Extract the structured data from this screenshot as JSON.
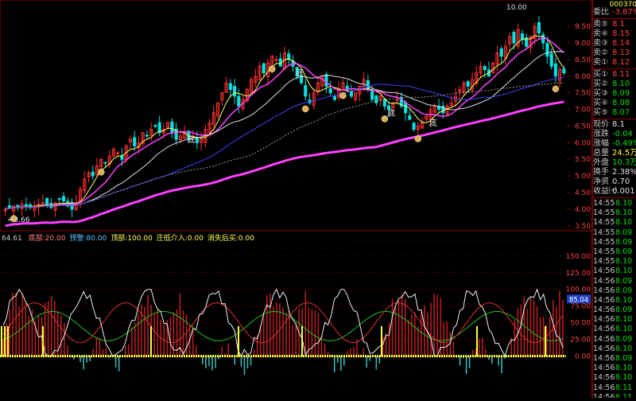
{
  "colors": {
    "up": "#ff3030",
    "down": "#00e0e0",
    "ma1": "#ffff60",
    "ma2": "#ff40ff",
    "ma3": "#e0e0e0",
    "ma4": "#4040ff",
    "ma5": "#888888",
    "bull": "#ff40ff",
    "grid": "#8b0000"
  },
  "top_chart": {
    "high_label": "10.00",
    "low_label": "←3.66",
    "signal_label": "底",
    "axis_ticks": [
      "9.50",
      "9.00",
      "8.50",
      "8.00",
      "7.50",
      "7.00",
      "6.50",
      "6.00",
      "5.50",
      "5.00",
      "4.50",
      "4.00",
      "3.50"
    ]
  },
  "indicator": {
    "header_value": "64.61",
    "legend": [
      {
        "text": "底部:20.00",
        "color": "#ff8080"
      },
      {
        "text": "预警:80.00",
        "color": "#60c0ff"
      },
      {
        "text": "顶部:100.00",
        "color": "#ffff60"
      },
      {
        "text": "庄低介入:0.00",
        "color": "#ffff60"
      },
      {
        "text": "消失后买:0.00",
        "color": "#ffff60"
      }
    ],
    "axis_ticks": [
      "150.00",
      "125.00",
      "100.00",
      "75.00",
      "50.00",
      "25.00",
      "0.00"
    ],
    "badge": "85.04"
  },
  "panel": {
    "code": "000370",
    "weibi": {
      "label": "委比",
      "value": "-3.87%"
    },
    "asks": [
      {
        "label": "卖⑤",
        "value": "8.1"
      },
      {
        "label": "卖④",
        "value": "8.15"
      },
      {
        "label": "卖③",
        "value": "8.14"
      },
      {
        "label": "卖②",
        "value": "8.13"
      },
      {
        "label": "卖①",
        "value": "8.12"
      }
    ],
    "bids": [
      {
        "label": "买①",
        "value": "8.11"
      },
      {
        "label": "买②",
        "value": "8.10"
      },
      {
        "label": "买③",
        "value": "8.09"
      },
      {
        "label": "买④",
        "value": "8.08"
      },
      {
        "label": "买⑤",
        "value": "8.07"
      }
    ],
    "stats": [
      {
        "label": "现价",
        "value": "8.1"
      },
      {
        "label": "涨跌",
        "value": "-0.04"
      },
      {
        "label": "涨幅",
        "value": "-0.49%"
      },
      {
        "label": "总量",
        "value": "24.5万"
      },
      {
        "label": "外盘",
        "value": "10.3万"
      },
      {
        "label": "换手",
        "value": "2.38%"
      },
      {
        "label": "净资",
        "value": "0.70"
      },
      {
        "label": "收益㈠",
        "value": "0.001"
      }
    ],
    "ticks": [
      {
        "time": "14:55",
        "price": "8.10"
      },
      {
        "time": "14:55",
        "price": "8.10"
      },
      {
        "time": "14:55",
        "price": "8.10"
      },
      {
        "time": "14:55",
        "price": "8.09"
      },
      {
        "time": "14:55",
        "price": "8.09"
      },
      {
        "time": "14:55",
        "price": "8.09"
      },
      {
        "time": "14:55",
        "price": "8.10"
      },
      {
        "time": "14:56",
        "price": "8.10"
      },
      {
        "time": "14:56",
        "price": "8.09"
      },
      {
        "time": "14:56",
        "price": "8.09"
      },
      {
        "time": "14:56",
        "price": "8.10"
      },
      {
        "time": "14:56",
        "price": "8.09"
      },
      {
        "time": "14:56",
        "price": "8.10"
      },
      {
        "time": "14:56",
        "price": "8.10"
      },
      {
        "time": "14:56",
        "price": "8.09"
      },
      {
        "time": "14:56",
        "price": "8.10"
      },
      {
        "time": "14:56",
        "price": "8.09"
      },
      {
        "time": "14:56",
        "price": "8.10"
      },
      {
        "time": "14:56",
        "price": "8.10"
      },
      {
        "time": "14:56",
        "price": "8.11"
      },
      {
        "time": "14:56",
        "price": "8.11"
      },
      {
        "time": "14:56",
        "price": "8.11"
      }
    ]
  },
  "chart_data": {
    "type": "candlestick",
    "ylim": [
      3.4,
      10.1
    ],
    "candles_note": "approximate daily OHLC sequence read off the chart",
    "closes": [
      4.0,
      4.05,
      4.1,
      4.05,
      4.15,
      4.1,
      4.05,
      4.1,
      4.15,
      4.2,
      4.1,
      4.05,
      4.2,
      4.3,
      4.25,
      4.1,
      4.0,
      4.2,
      4.6,
      4.9,
      5.1,
      5.0,
      5.3,
      5.5,
      5.4,
      5.6,
      5.8,
      5.7,
      5.5,
      5.9,
      6.1,
      5.9,
      6.0,
      6.3,
      6.2,
      6.4,
      6.5,
      6.3,
      6.4,
      6.6,
      6.3,
      6.1,
      6.2,
      6.3,
      6.1,
      6.2,
      6.0,
      6.1,
      6.4,
      6.6,
      6.9,
      7.2,
      7.5,
      7.8,
      7.6,
      7.4,
      7.1,
      7.3,
      7.6,
      7.9,
      8.0,
      8.3,
      8.1,
      8.4,
      8.6,
      8.5,
      8.3,
      8.7,
      8.5,
      8.3,
      8.0,
      7.8,
      7.4,
      7.2,
      7.5,
      7.8,
      8.0,
      7.7,
      7.5,
      7.3,
      7.6,
      7.8,
      7.6,
      7.4,
      7.5,
      7.7,
      7.9,
      7.6,
      7.3,
      7.2,
      7.4,
      7.1,
      7.0,
      7.2,
      7.3,
      7.1,
      6.9,
      6.7,
      6.4,
      6.5,
      6.6,
      6.8,
      7.0,
      7.1,
      7.0,
      6.9,
      7.1,
      7.2,
      7.4,
      7.6,
      7.8,
      7.7,
      7.9,
      8.1,
      8.3,
      8.2,
      8.0,
      8.4,
      8.7,
      8.6,
      8.9,
      9.2,
      9.0,
      9.4,
      9.1,
      8.9,
      9.2,
      9.5,
      9.3,
      9.0,
      8.6,
      8.3,
      8.0,
      8.2,
      8.1
    ],
    "ma_series": [
      {
        "name": "MA5",
        "color": "#ffff60"
      },
      {
        "name": "MA10",
        "color": "#ff40ff"
      },
      {
        "name": "MA20",
        "color": "#e0e0e0"
      },
      {
        "name": "MA60",
        "color": "#4040ff"
      },
      {
        "name": "MA120",
        "color": "#888888"
      }
    ],
    "indicator_ylim": [
      -60,
      170
    ]
  }
}
